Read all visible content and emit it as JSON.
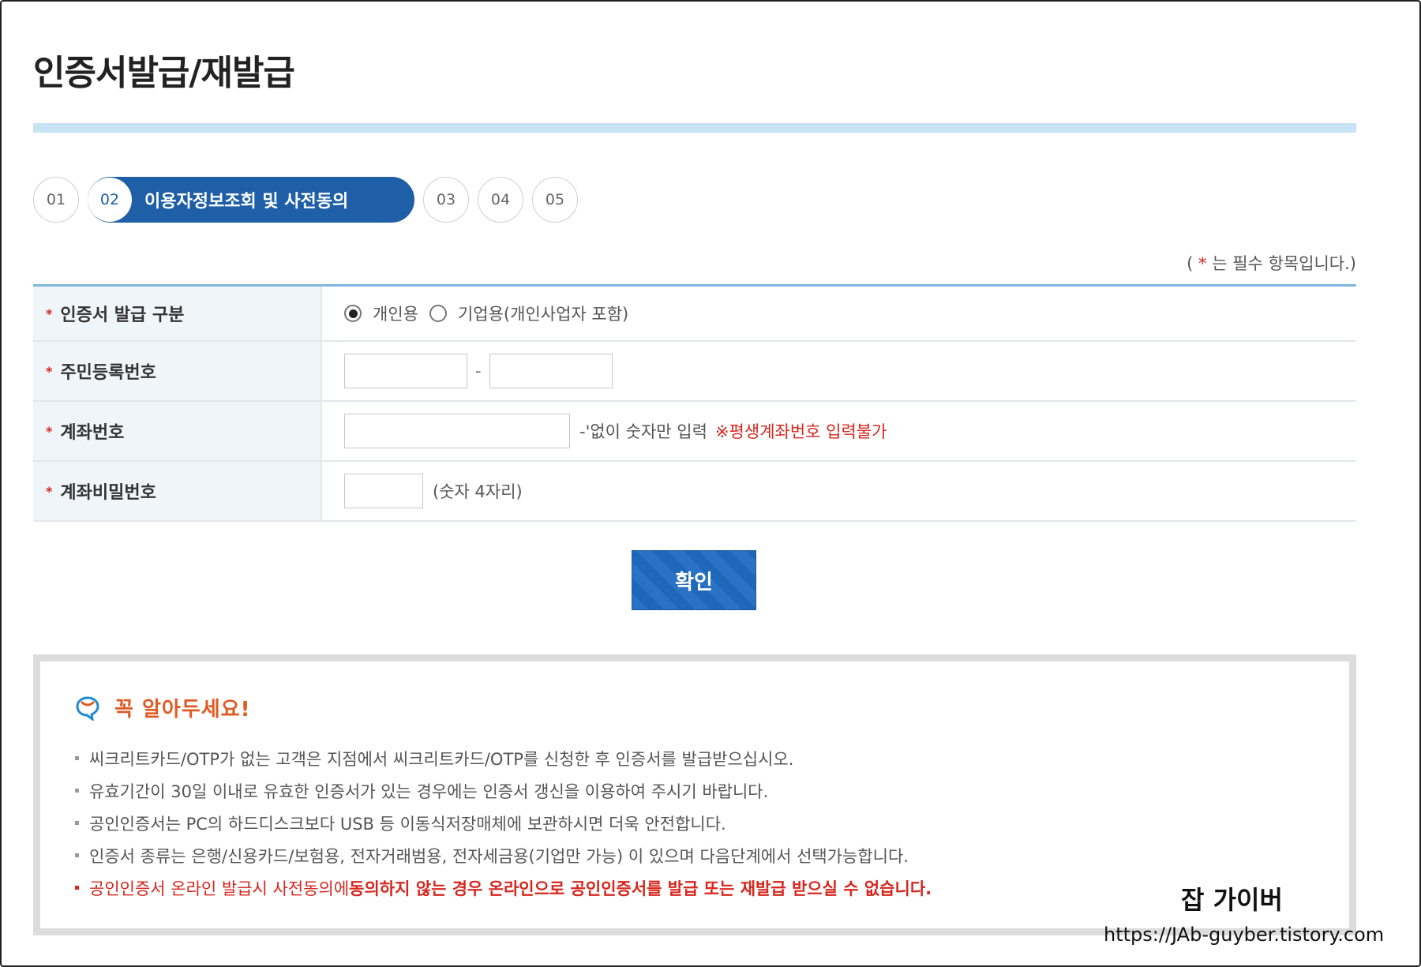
{
  "page": {
    "title": "인증서발급/재발급"
  },
  "steps": [
    {
      "num": "01"
    },
    {
      "num": "02",
      "label": "이용자정보조회 및 사전동의"
    },
    {
      "num": "03"
    },
    {
      "num": "04"
    },
    {
      "num": "05"
    }
  ],
  "required_note": {
    "prefix": "( ",
    "star": "*",
    "text": " 는 필수 항목입니다.)"
  },
  "form": {
    "cert_type": {
      "label": "인증서 발급 구분",
      "options": [
        {
          "label": "개인용",
          "selected": true
        },
        {
          "label": "기업용(개인사업자 포함)",
          "selected": false
        }
      ]
    },
    "resident_number": {
      "label": "주민등록번호",
      "separator": "-",
      "part1": "",
      "part2": ""
    },
    "account_number": {
      "label": "계좌번호",
      "value": "",
      "hint": "-'없이 숫자만 입력",
      "warning": "※평생계좌번호 입력불가"
    },
    "account_password": {
      "label": "계좌비밀번호",
      "value": "",
      "hint": "(숫자 4자리)"
    }
  },
  "confirm_button": {
    "label": "확인"
  },
  "notice": {
    "icon": "notice-bubble-icon",
    "title": "꼭 알아두세요!",
    "items": [
      "씨크리트카드/OTP가 없는 고객은 지점에서 씨크리트카드/OTP를 신청한 후 인증서를 발급받으십시오.",
      "유효기간이 30일 이내로 유효한 인증서가 있는 경우에는 인증서 갱신을 이용하여 주시기 바랍니다.",
      "공인인증서는 PC의 하드디스크보다 USB 등 이동식저장매체에 보관하시면 더욱 안전합니다.",
      "인증서 종류는 은행/신용카드/보험용, 전자거래범용, 전자세금용(기업만 가능) 이 있으며 다음단계에서 선택가능합니다."
    ],
    "last_item": {
      "text_normal": "공인인증서 온라인 발급시 사전동의에 ",
      "text_bold": "동의하지 않는 경우 온라인으로 공인인증서를 발급 또는 재발급 받으실 수 없습니다."
    }
  },
  "watermark": {
    "title": "잡 가이버",
    "url": "https://JAb-guyber.tistory.com"
  },
  "colors": {
    "primary": "#1f5fa8",
    "required": "#d7261e",
    "notice_title": "#e05a24",
    "header_rule": "#c8e3f3"
  }
}
